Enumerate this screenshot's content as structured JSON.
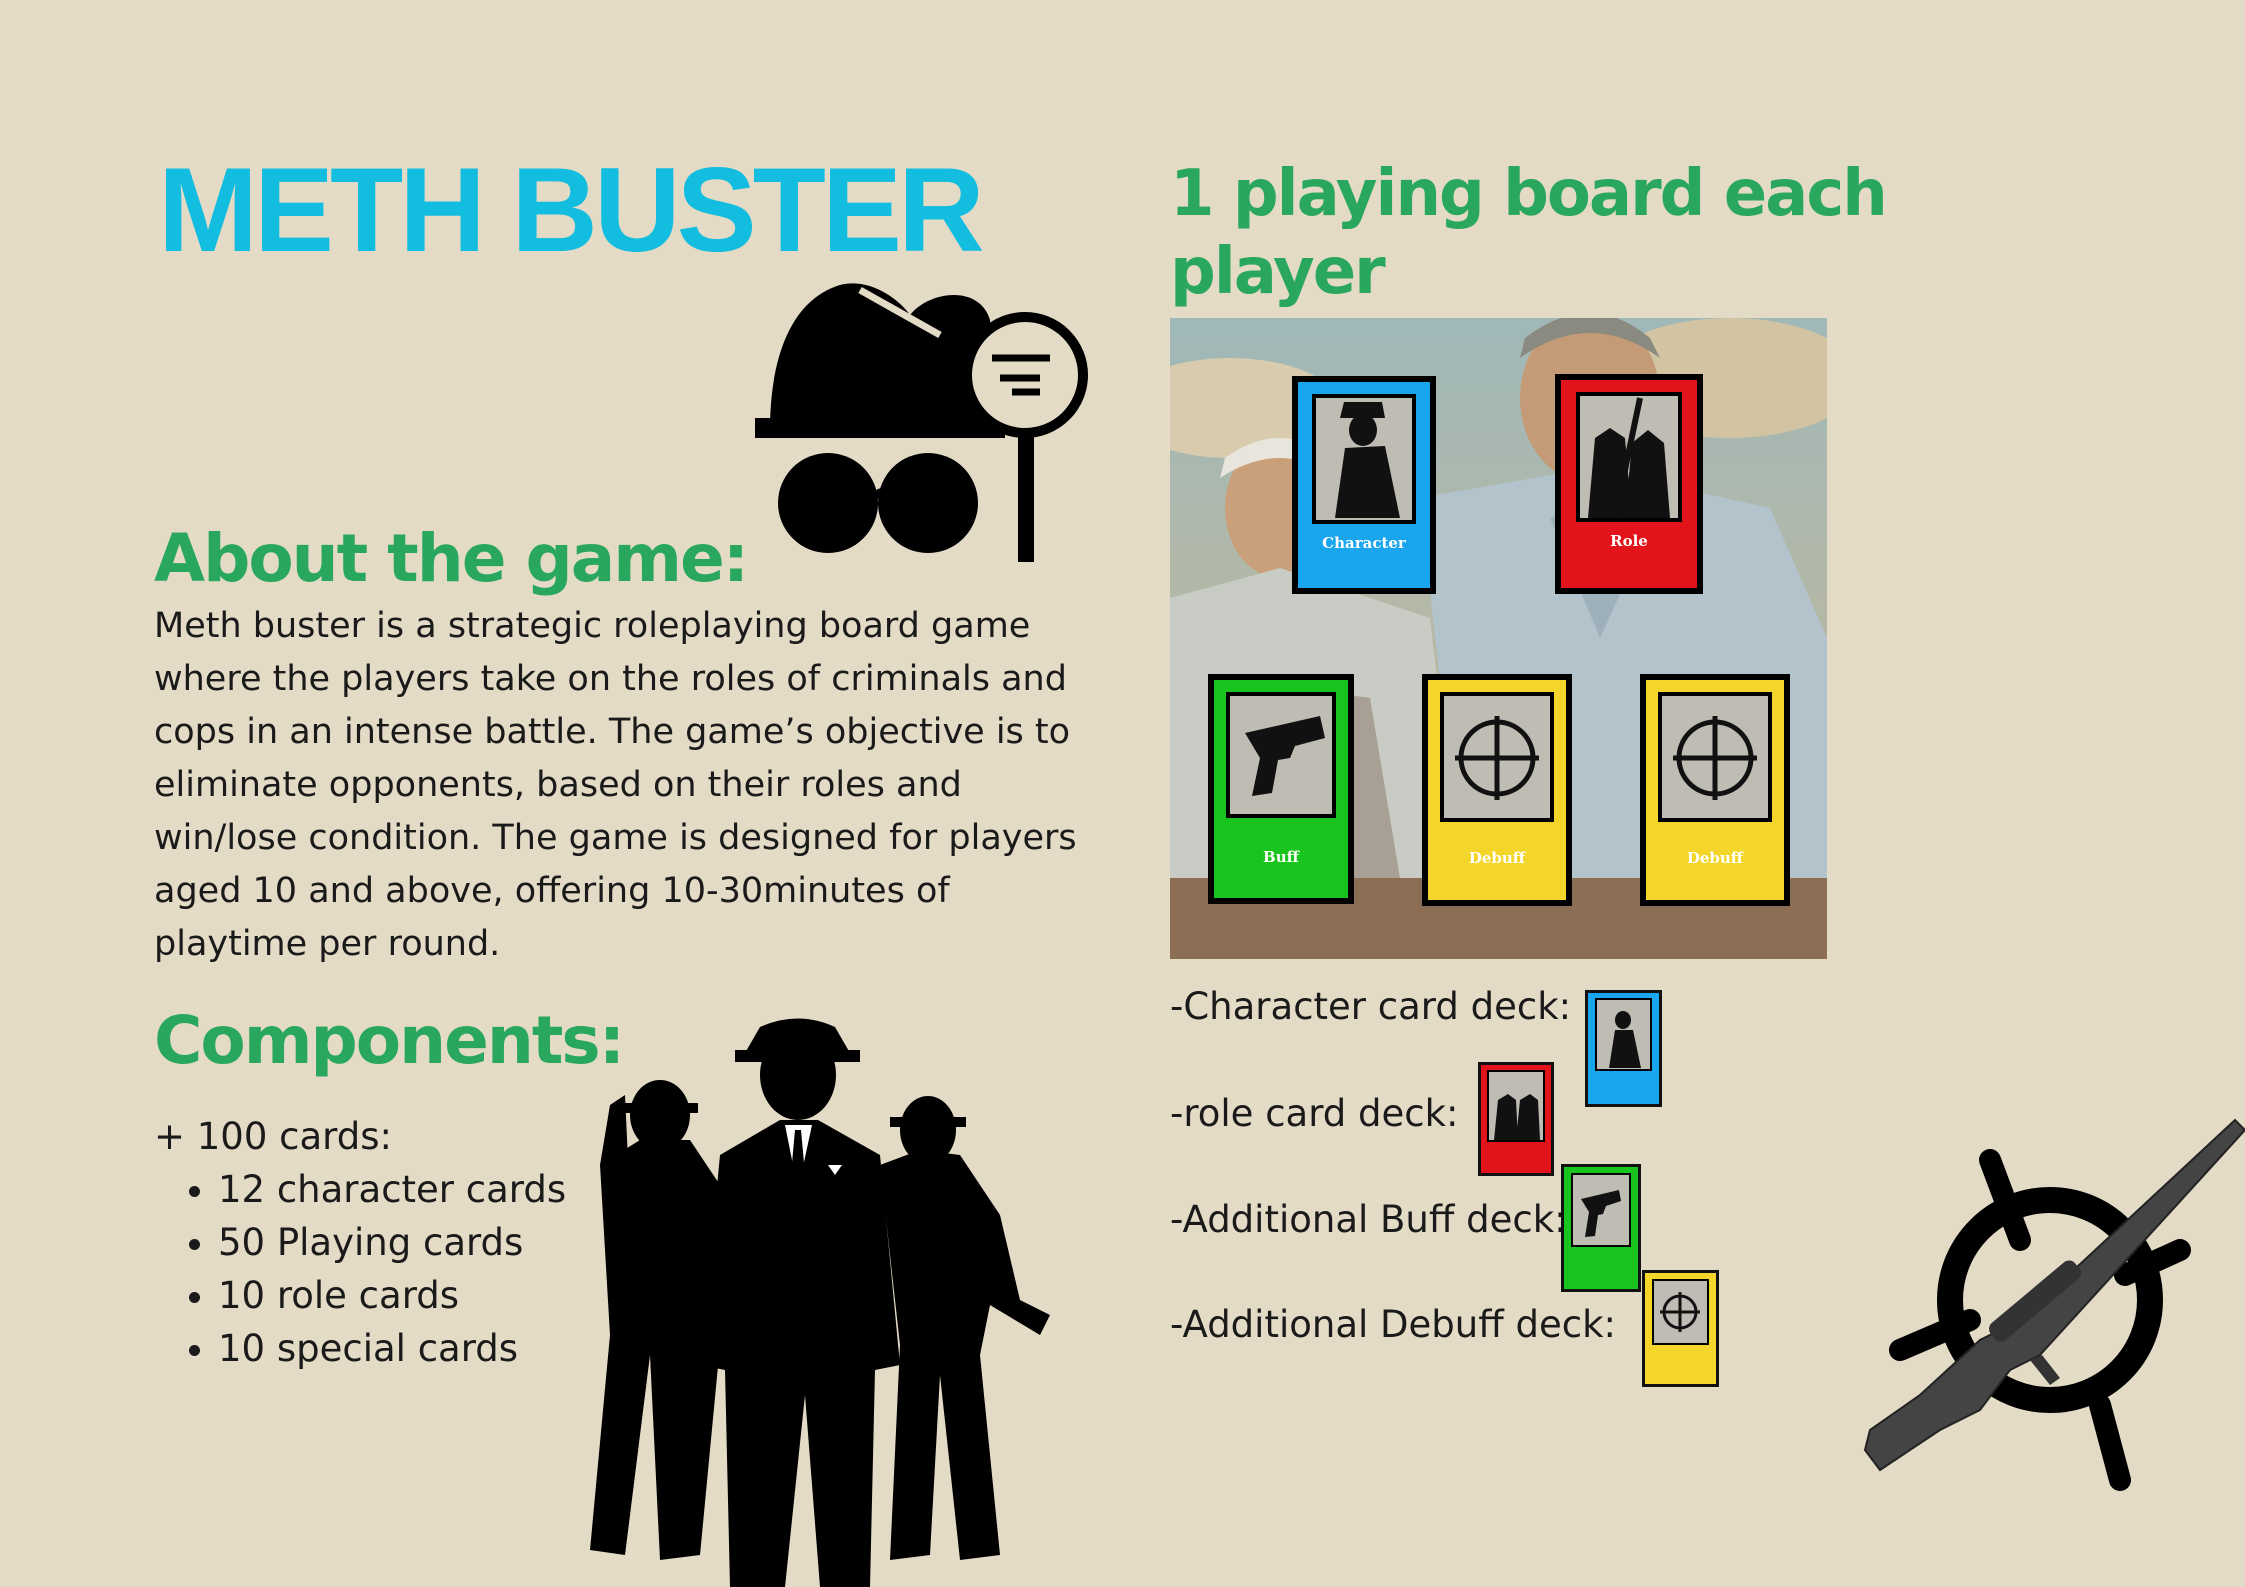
{
  "title": "METH BUSTER",
  "about": {
    "heading": "About the game:",
    "body": "Meth buster is a strategic roleplaying board game where the players take on the roles of criminals and cops in an intense battle. The game’s objective is to eliminate opponents, based on their roles and win/lose condition. The game is designed for players aged 10 and above, offering 10-30minutes of playtime per round."
  },
  "components": {
    "heading": "Components:",
    "intro": "+ 100 cards:",
    "items": [
      "12 character cards",
      "50 Playing cards",
      "10 role cards",
      "10 special cards"
    ]
  },
  "board": {
    "heading": "1 playing board each player",
    "cards": [
      {
        "label": "Character",
        "color": "#1aa6ee",
        "icon": "detective-silhouette-icon"
      },
      {
        "label": "Role",
        "color": "#e3131b",
        "icon": "gang-silhouette-icon"
      },
      {
        "label": "Buff",
        "color": "#19c41e",
        "icon": "pistol-icon"
      },
      {
        "label": "Debuff",
        "color": "#f4d62b",
        "icon": "crosshair-icon"
      },
      {
        "label": "Debuff",
        "color": "#f4d62b",
        "icon": "crosshair-icon"
      }
    ]
  },
  "decks": [
    {
      "label": "-Character card deck:",
      "card": "Character"
    },
    {
      "label": "-role card deck:",
      "card": "Role"
    },
    {
      "label": "-Additional Buff deck:",
      "card": "Buff"
    },
    {
      "label": "-Additional Debuff deck:",
      "card": "Debuff"
    }
  ],
  "colors": {
    "background": "#e4dbc6",
    "title": "#12bde0",
    "heading": "#2aa75f"
  }
}
